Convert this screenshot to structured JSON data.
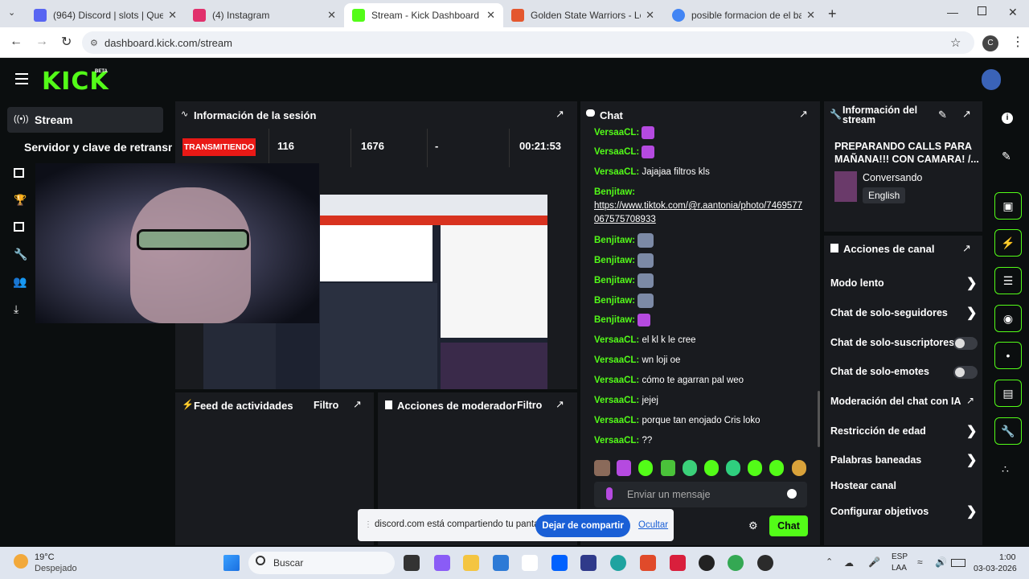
{
  "browser": {
    "tabs": [
      {
        "title": "(964) Discord | slots | Que ¡",
        "color": "#5865f2"
      },
      {
        "title": "(4) Instagram",
        "color": "#e1306c"
      },
      {
        "title": "Stream - Kick Dashboard",
        "color": "#53fc18"
      },
      {
        "title": "Golden State Warriors - Los Ang",
        "color": "#e4572e"
      },
      {
        "title": "posible formacion de el barcelo",
        "color": "#4285f4"
      }
    ],
    "url": "dashboard.kick.com/stream"
  },
  "header": {
    "logo": "KICK",
    "beta": "BETA"
  },
  "sidebar": {
    "stream_label": "Stream",
    "server_key_label": "Servidor y clave de retransm"
  },
  "session": {
    "title": "Información de la sesión",
    "status": "TRANSMITIENDO",
    "viewers": "116",
    "followers": "1676",
    "subs": "-",
    "time": "00:21:53"
  },
  "feed": {
    "title": "Feed de actividades",
    "filter": "Filtro"
  },
  "moderator": {
    "title": "Acciones de moderador",
    "filter": "Filtro"
  },
  "chat": {
    "title": "Chat",
    "messages": [
      {
        "user": "VersaaCL:",
        "text": ""
      },
      {
        "user": "VersaaCL:",
        "text": ""
      },
      {
        "user": "VersaaCL:",
        "text": "Jajajaa filtros kls"
      },
      {
        "user": "Benjitaw:",
        "text": "https://www.tiktok.com/@r.aantonia/photo/7469577067575708933"
      },
      {
        "user": "Benjitaw:",
        "text": ""
      },
      {
        "user": "Benjitaw:",
        "text": ""
      },
      {
        "user": "Benjitaw:",
        "text": ""
      },
      {
        "user": "Benjitaw:",
        "text": ""
      },
      {
        "user": "Benjitaw:",
        "text": ""
      },
      {
        "user": "VersaaCL:",
        "text": "el kl k le cree"
      },
      {
        "user": "VersaaCL:",
        "text": "wn loji oe"
      },
      {
        "user": "VersaaCL:",
        "text": "cómo te agarran pal weo"
      },
      {
        "user": "VersaaCL:",
        "text": "jejej"
      },
      {
        "user": "VersaaCL:",
        "text": "porque tan enojado Cris loko"
      },
      {
        "user": "VersaaCL:",
        "text": "??"
      }
    ],
    "input_placeholder": "Enviar un mensaje",
    "send_label": "Chat"
  },
  "share_banner": {
    "text": "discord.com está compartiendo tu pantalla.",
    "stop_label": "Dejar de compartir",
    "hide_label": "Ocultar"
  },
  "stream_info": {
    "title": "Información del stream",
    "stream_title": "PREPARANDO CALLS PARA MAÑANA!!! CON CAMARA! /...",
    "category": "Conversando",
    "language": "English"
  },
  "channel_actions": {
    "title": "Acciones de canal",
    "items": [
      {
        "label": "Modo lento",
        "control": "chevron"
      },
      {
        "label": "Chat de solo-seguidores",
        "control": "chevron"
      },
      {
        "label": "Chat de solo-suscriptores",
        "control": "toggle"
      },
      {
        "label": "Chat de solo-emotes",
        "control": "toggle"
      },
      {
        "label": "Moderación del chat con IA",
        "control": "external"
      },
      {
        "label": "Restricción de edad",
        "control": "chevron"
      },
      {
        "label": "Palabras baneadas",
        "control": "chevron"
      },
      {
        "label": "Hostear canal",
        "control": "none"
      },
      {
        "label": "Configurar objetivos",
        "control": "chevron"
      }
    ]
  },
  "taskbar": {
    "weather_temp": "19°C",
    "weather_desc": "Despejado",
    "search_label": "Buscar",
    "lang": "ESP",
    "lang2": "LAA",
    "time": "1:00",
    "date": "03-03-2026"
  },
  "colors": {
    "accent": "#53fc18",
    "live": "#e91916",
    "panel": "#191b1f"
  }
}
